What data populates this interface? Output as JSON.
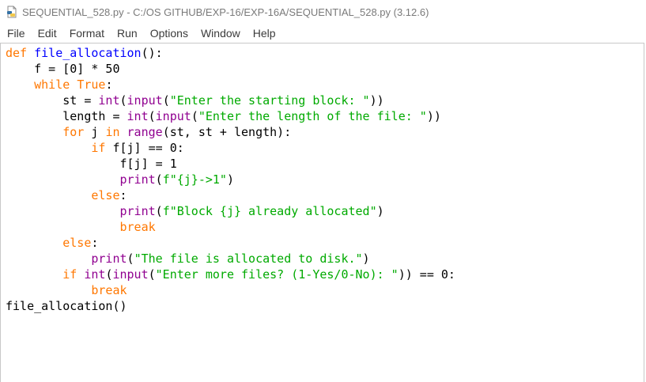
{
  "window": {
    "title": "SEQUENTIAL_528.py - C:/OS GITHUB/EXP-16/EXP-16A/SEQUENTIAL_528.py (3.12.6)",
    "icon": "python-file-icon"
  },
  "menu": [
    "File",
    "Edit",
    "Format",
    "Run",
    "Options",
    "Window",
    "Help"
  ],
  "code_lines": [
    [
      [
        "k",
        "def"
      ],
      [
        "t",
        " "
      ],
      [
        "d",
        "file_allocation"
      ],
      [
        "t",
        "():"
      ]
    ],
    [
      [
        "t",
        "    f = [0] * 50"
      ]
    ],
    [
      [
        "t",
        "    "
      ],
      [
        "k",
        "while"
      ],
      [
        "t",
        " "
      ],
      [
        "k",
        "True"
      ],
      [
        "t",
        ":"
      ]
    ],
    [
      [
        "t",
        "        st = "
      ],
      [
        "b",
        "int"
      ],
      [
        "t",
        "("
      ],
      [
        "b",
        "input"
      ],
      [
        "t",
        "("
      ],
      [
        "s",
        "\"Enter the starting block: \""
      ],
      [
        "t",
        "))"
      ]
    ],
    [
      [
        "t",
        "        length = "
      ],
      [
        "b",
        "int"
      ],
      [
        "t",
        "("
      ],
      [
        "b",
        "input"
      ],
      [
        "t",
        "("
      ],
      [
        "s",
        "\"Enter the length of the file: \""
      ],
      [
        "t",
        "))"
      ]
    ],
    [
      [
        "t",
        "        "
      ],
      [
        "k",
        "for"
      ],
      [
        "t",
        " j "
      ],
      [
        "k",
        "in"
      ],
      [
        "t",
        " "
      ],
      [
        "b",
        "range"
      ],
      [
        "t",
        "(st, st + length):"
      ]
    ],
    [
      [
        "t",
        "            "
      ],
      [
        "k",
        "if"
      ],
      [
        "t",
        " f[j] == 0:"
      ]
    ],
    [
      [
        "t",
        "                f[j] = 1"
      ]
    ],
    [
      [
        "t",
        "                "
      ],
      [
        "b",
        "print"
      ],
      [
        "t",
        "("
      ],
      [
        "s",
        "f\"{j}->1\""
      ],
      [
        "t",
        ")"
      ]
    ],
    [
      [
        "t",
        "            "
      ],
      [
        "k",
        "else"
      ],
      [
        "t",
        ":"
      ]
    ],
    [
      [
        "t",
        "                "
      ],
      [
        "b",
        "print"
      ],
      [
        "t",
        "("
      ],
      [
        "s",
        "f\"Block {j} already allocated\""
      ],
      [
        "t",
        ")"
      ]
    ],
    [
      [
        "t",
        "                "
      ],
      [
        "k",
        "break"
      ]
    ],
    [
      [
        "t",
        "        "
      ],
      [
        "k",
        "else"
      ],
      [
        "t",
        ":"
      ]
    ],
    [
      [
        "t",
        "            "
      ],
      [
        "b",
        "print"
      ],
      [
        "t",
        "("
      ],
      [
        "s",
        "\"The file is allocated to disk.\""
      ],
      [
        "t",
        ")"
      ]
    ],
    [
      [
        "t",
        "        "
      ],
      [
        "k",
        "if"
      ],
      [
        "t",
        " "
      ],
      [
        "b",
        "int"
      ],
      [
        "t",
        "("
      ],
      [
        "b",
        "input"
      ],
      [
        "t",
        "("
      ],
      [
        "s",
        "\"Enter more files? (1-Yes/0-No): \""
      ],
      [
        "t",
        ")) == 0:"
      ]
    ],
    [
      [
        "t",
        "            "
      ],
      [
        "k",
        "break"
      ]
    ],
    [
      [
        "t",
        "file_allocation()"
      ]
    ]
  ],
  "colors": {
    "keyword": "#ff7700",
    "definition": "#0000ff",
    "builtin": "#900090",
    "string": "#00aa00",
    "default": "#000000"
  }
}
